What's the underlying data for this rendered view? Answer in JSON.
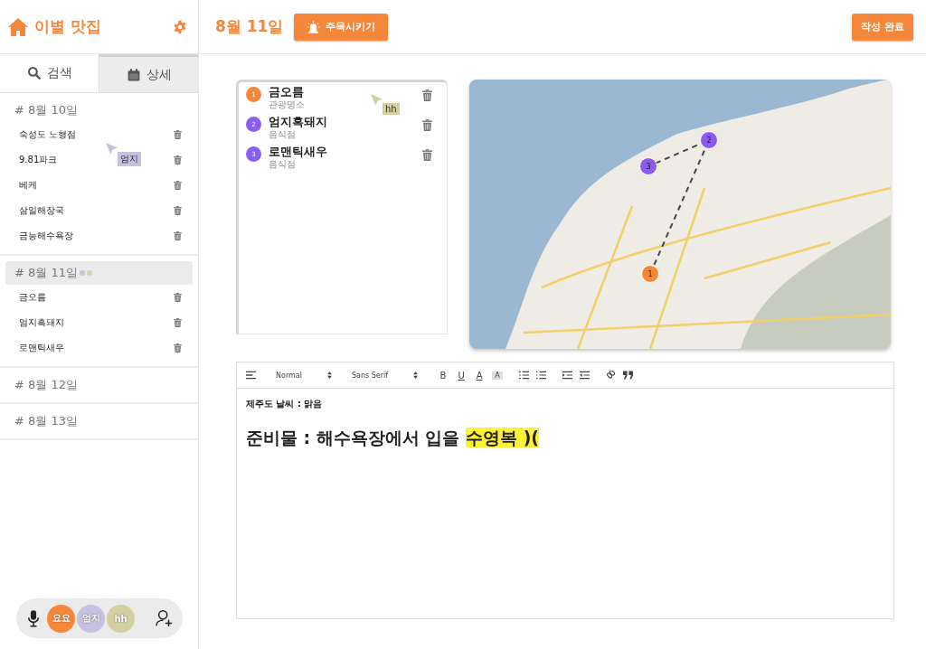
{
  "sidebar": {
    "title": "이별 맛집",
    "tabs": [
      {
        "label": "검색",
        "selected": false
      },
      {
        "label": "상세",
        "selected": true
      }
    ],
    "days": [
      {
        "label": "# 8월 10일",
        "selected": false,
        "places": [
          "숙성도 노형점",
          "9.81파크",
          "베케",
          "삼일해장국",
          "금능해수욕장"
        ]
      },
      {
        "label": "# 8월 11일",
        "selected": true,
        "presence": [
          {
            "color": "#c8c6dc"
          },
          {
            "color": "#d8d4a8"
          }
        ],
        "places": [
          "금오름",
          "엄지흑돼지",
          "로맨틱새우"
        ]
      },
      {
        "label": "# 8월 12일",
        "selected": false
      },
      {
        "label": "# 8월 13일",
        "selected": false
      }
    ],
    "call_users": [
      {
        "label": "요요",
        "color": "#f5873a"
      },
      {
        "label": "엄지",
        "color": "#c5c1e0"
      },
      {
        "label": "hh",
        "color": "#d4cf9f"
      }
    ]
  },
  "header": {
    "date": "8월 11일",
    "alert_button": "주목시키기",
    "done_button": "작성 완료"
  },
  "places": [
    {
      "number": "1",
      "name": "금오름",
      "category": "관광명소",
      "color": "#f5873a"
    },
    {
      "number": "2",
      "name": "엄지흑돼지",
      "category": "음식점",
      "color": "#8b5cf0"
    },
    {
      "number": "3",
      "name": "로맨틱새우",
      "category": "음식점",
      "color": "#8b5cf0"
    }
  ],
  "map_markers": [
    {
      "number": "1",
      "color": "#f5873a"
    },
    {
      "number": "2",
      "color": "#8b5cf0"
    },
    {
      "number": "3",
      "color": "#8b5cf0"
    }
  ],
  "editor": {
    "header_select": "Normal",
    "font_select": "Sans Serif",
    "format_keys": [
      "B",
      "U",
      "A",
      "A"
    ],
    "lines": [
      {
        "kind": "small",
        "segments": [
          {
            "text": "제주도 날씨 : 맑음",
            "highlight": false
          }
        ]
      },
      {
        "kind": "heading",
        "segments": [
          {
            "text": "준비물 : 해수욕장에서 입을 ",
            "highlight": false
          },
          {
            "text": "수영복 )(",
            "highlight": true
          }
        ]
      }
    ]
  },
  "cursors": [
    {
      "label": "엄지",
      "color": "#c5c1e0"
    },
    {
      "label": "hh",
      "color": "#d4cf9f"
    }
  ]
}
